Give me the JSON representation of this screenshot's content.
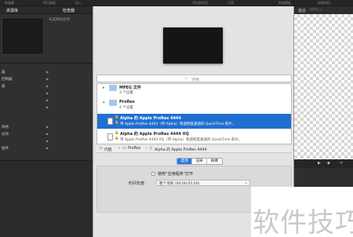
{
  "topbar": {
    "items": [
      "检查器",
      "项目面板",
      "导入",
      "添加到项目",
      "分享",
      "附加模板",
      "创建项目"
    ]
  },
  "left_panel": {
    "tab_library": "资源库",
    "tab_inspector": "检查器",
    "no_selection": "未选择任何项",
    "items": [
      "器",
      "控制器",
      "器",
      "",
      "",
      "",
      "风格",
      "光效",
      "",
      "",
      "插件"
    ]
  },
  "canvas": {
    "fit_label": "适合",
    "fit_value": "50% ◇"
  },
  "sheet": {
    "search_placeholder": "搜索",
    "rows": [
      {
        "title": "MPEG 文件",
        "subtitle": "3 个设置"
      },
      {
        "title": "ProRes",
        "subtitle": "4 个设置"
      },
      {
        "title": "Alpha 的 Apple ProRes 4444",
        "subtitle": "带 Apple ProRes 4444（带 Alpha）和透明度通道的 QuickTime 影片。"
      },
      {
        "title": "Alpha 的 Apple ProRes 4444 XQ",
        "subtitle": "带 Apple ProRes 4444 XQ（带 Alpha）和透明度通道的 QuickTime 影片。"
      }
    ],
    "path": [
      "内建",
      "ProRes",
      "Alpha 的 Apple ProRes 4444"
    ],
    "tabs": [
      "选项",
      "渲染",
      "摘要"
    ],
    "use_app_label": "使用“应用程序”打开",
    "duration_label": "时间长度：",
    "duration_value": "整个项目 (00:00:05;00)"
  },
  "watermark": "软件技巧",
  "colors": {
    "selection": "#1f6fd1",
    "sheet_bg": "#e3e3e3",
    "panel_bg": "#303030"
  }
}
